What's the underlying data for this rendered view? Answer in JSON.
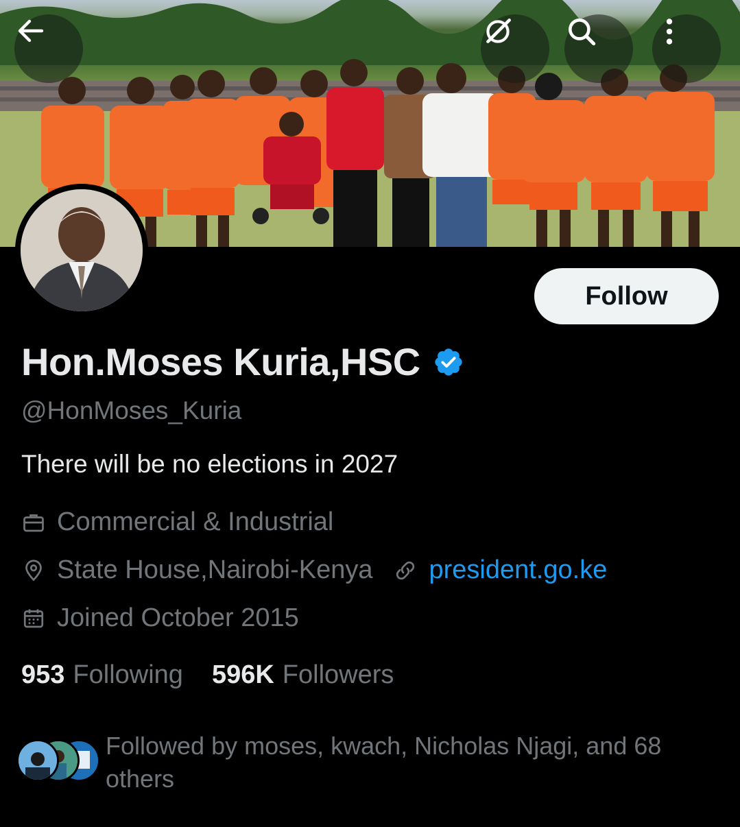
{
  "header": {
    "back_icon": "arrow-left-icon",
    "grok_icon": "grok-icon",
    "search_icon": "search-icon",
    "more_icon": "more-vertical-icon"
  },
  "profile": {
    "name": "Hon.Moses Kuria,HSC",
    "verified": true,
    "handle": "@HonMoses_Kuria",
    "bio": "There will be no elections in 2027",
    "category": "Commercial & Industrial",
    "location": "State House,Nairobi-Kenya",
    "website": "president.go.ke",
    "joined": "Joined October 2015",
    "follow_label": "Follow"
  },
  "stats": {
    "following_count": "953",
    "following_label": "Following",
    "followers_count": "596K",
    "followers_label": "Followers"
  },
  "followed_by": {
    "text_line1": "Followed by moses, kwach, Nicholas Njagi, and 68",
    "text_line2": "others"
  },
  "colors": {
    "background": "#000000",
    "primary_text": "#e7e9ea",
    "secondary_text": "#71767b",
    "link": "#1d9bf0",
    "verified_badge": "#1d9bf0",
    "follow_button_bg": "#eff3f4",
    "jersey": "#f26b2a"
  }
}
